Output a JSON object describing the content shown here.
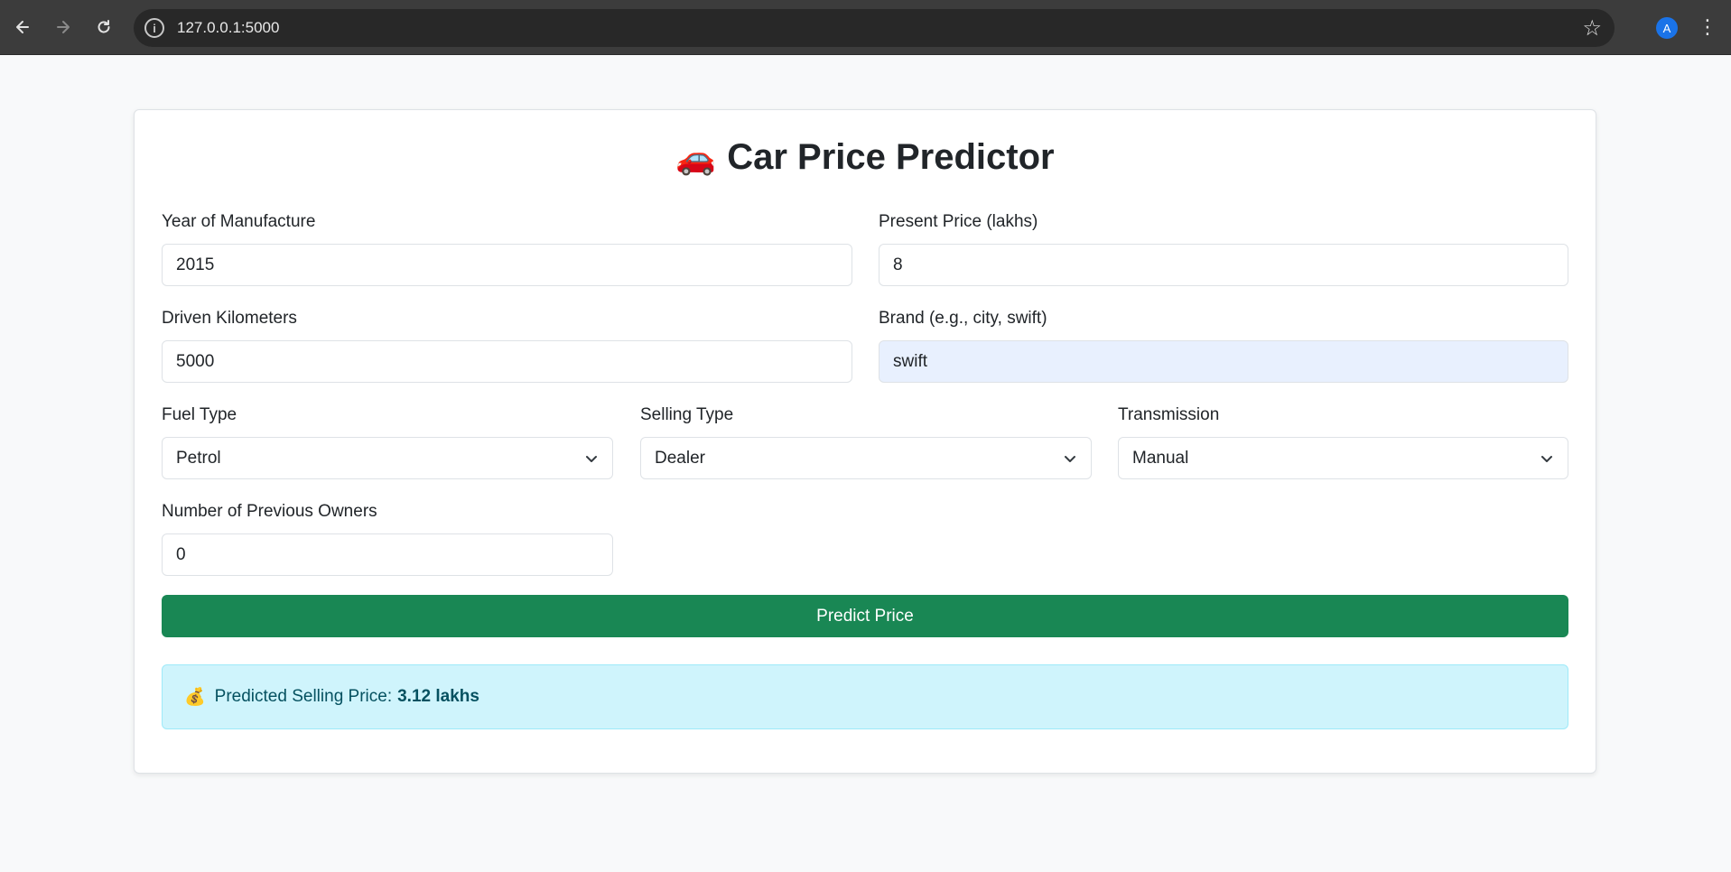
{
  "browser": {
    "url": "127.0.0.1:5000",
    "avatar_letter": "A"
  },
  "page": {
    "title": "Car Price Predictor",
    "title_icon": "🚗"
  },
  "form": {
    "year": {
      "label": "Year of Manufacture",
      "value": "2015"
    },
    "present_price": {
      "label": "Present Price (lakhs)",
      "value": "8"
    },
    "kms": {
      "label": "Driven Kilometers",
      "value": "5000"
    },
    "brand": {
      "label": "Brand (e.g., city, swift)",
      "value": "swift"
    },
    "fuel_type": {
      "label": "Fuel Type",
      "value": "Petrol"
    },
    "selling_type": {
      "label": "Selling Type",
      "value": "Dealer"
    },
    "transmission": {
      "label": "Transmission",
      "value": "Manual"
    },
    "owners": {
      "label": "Number of Previous Owners",
      "value": "0"
    }
  },
  "actions": {
    "predict_label": "Predict Price"
  },
  "result": {
    "icon": "💰",
    "prefix": "Predicted Selling Price:",
    "value": "3.12 lakhs"
  },
  "colors": {
    "primary_button": "#198754",
    "result_bg": "#cff4fc",
    "autofill_bg": "#e8f0fe"
  }
}
